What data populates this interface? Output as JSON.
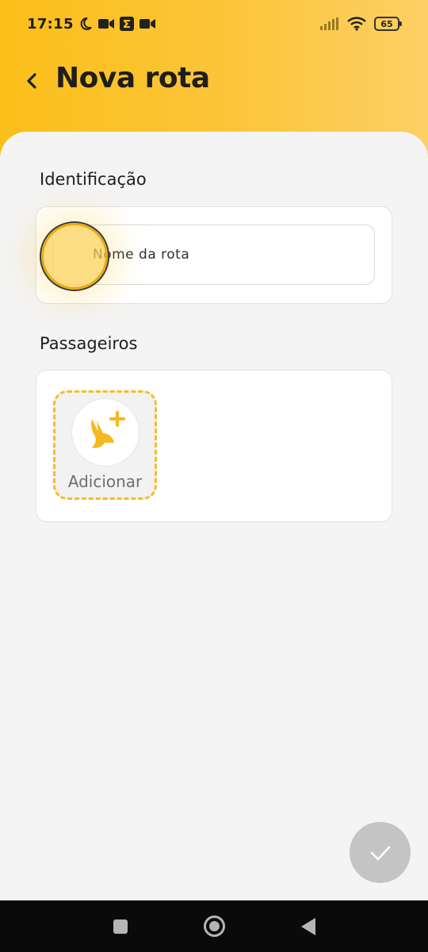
{
  "status_bar": {
    "time": "17:15",
    "battery": "65",
    "icons": [
      "moon-icon",
      "video-icon",
      "sigma-app-icon",
      "video-icon",
      "signal-icon",
      "wifi-icon",
      "battery-icon"
    ]
  },
  "header": {
    "title": "Nova rota",
    "back_icon": "chevron-left-icon",
    "background_color": "#fbbf1a"
  },
  "identification": {
    "label": "Identificação",
    "name_input_value": "Nome da rota"
  },
  "passengers": {
    "label": "Passageiros",
    "add_label": "Adicionar",
    "add_icon": "kangaroo-plus-icon",
    "accent_color": "#f5be27"
  },
  "fab": {
    "icon": "check-icon",
    "state": "disabled"
  },
  "nav_bar": {
    "icons": [
      "recents-icon",
      "home-icon",
      "back-icon"
    ]
  }
}
